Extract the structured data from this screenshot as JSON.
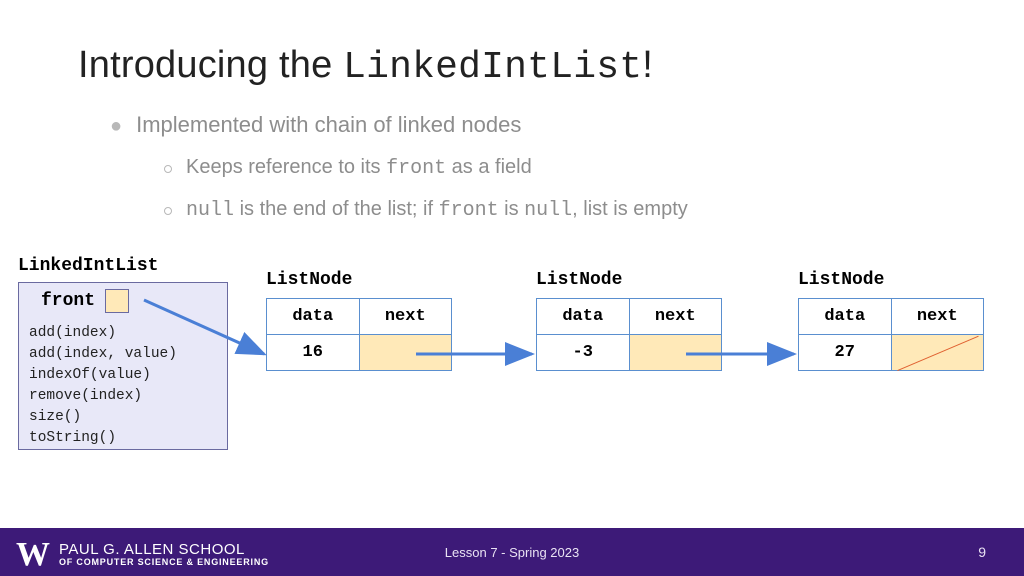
{
  "title": {
    "prefix": "Introducing the ",
    "code": "LinkedIntList",
    "suffix": "!"
  },
  "bullets": {
    "b1": "Implemented with chain of linked nodes",
    "s1": {
      "pre": "Keeps reference to its ",
      "c1": "front",
      "post": " as a field"
    },
    "s2": {
      "c1": "null",
      "t1": " is the end of the list; if ",
      "c2": "front",
      "t2": " is ",
      "c3": "null",
      "t3": ", list is empty"
    }
  },
  "lil": {
    "class_label": "LinkedIntList",
    "front_label": "front",
    "methods": [
      "add(index)",
      "add(index, value)",
      "indexOf(value)",
      "remove(index)",
      "size()",
      "toString()"
    ]
  },
  "node_label": "ListNode",
  "headers": {
    "data": "data",
    "next": "next"
  },
  "nodes": [
    {
      "value": "16"
    },
    {
      "value": "-3"
    },
    {
      "value": "27"
    }
  ],
  "footer": {
    "center": "Lesson 7 - Spring 2023",
    "page": "9",
    "logo_w": "W",
    "school1": "PAUL G. ALLEN SCHOOL",
    "school2": "OF COMPUTER SCIENCE & ENGINEERING"
  }
}
